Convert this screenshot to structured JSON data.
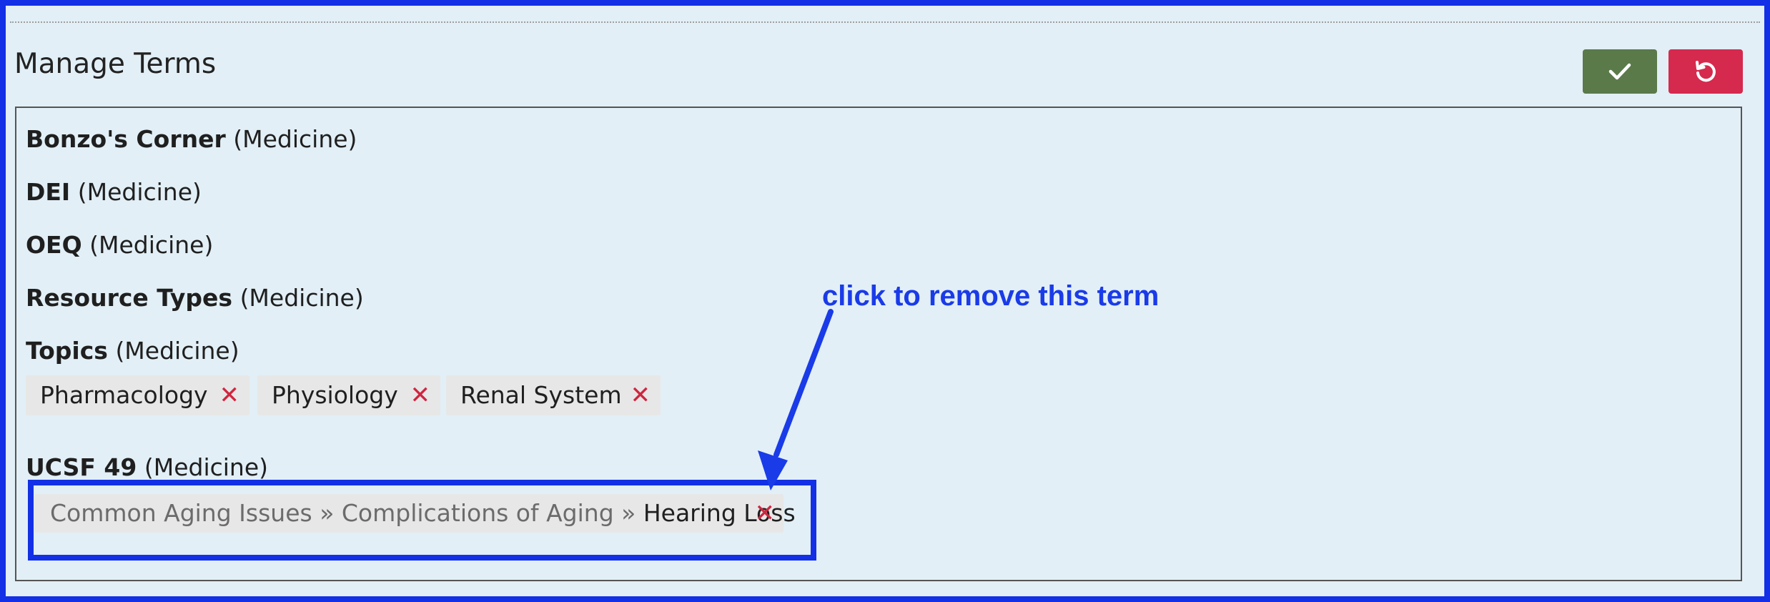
{
  "header": {
    "title": "Manage Terms",
    "save_icon": "check-icon",
    "reset_icon": "undo-icon",
    "save_color": "#5a7a4a",
    "reset_color": "#d6294e"
  },
  "vocabularies": [
    {
      "name": "Bonzo's Corner",
      "school": "(Medicine)"
    },
    {
      "name": "DEI",
      "school": "(Medicine)"
    },
    {
      "name": "OEQ",
      "school": "(Medicine)"
    },
    {
      "name": "Resource Types",
      "school": "(Medicine)"
    },
    {
      "name": "Topics",
      "school": "(Medicine)"
    },
    {
      "name": "UCSF 49",
      "school": "(Medicine)"
    }
  ],
  "topic_terms": [
    {
      "label": "Pharmacology",
      "remove_glyph": "✕"
    },
    {
      "label": "Physiology",
      "remove_glyph": "✕"
    },
    {
      "label": "Renal System",
      "remove_glyph": "✕"
    }
  ],
  "ucsf_term": {
    "parent_1": "Common Aging Issues",
    "sep_1": " » ",
    "parent_2": "Complications of Aging",
    "sep_2": " » ",
    "term": "Hearing Loss",
    "remove_glyph": "✕"
  },
  "annotation": {
    "text": "click to remove this term",
    "color": "#1a3be8"
  }
}
